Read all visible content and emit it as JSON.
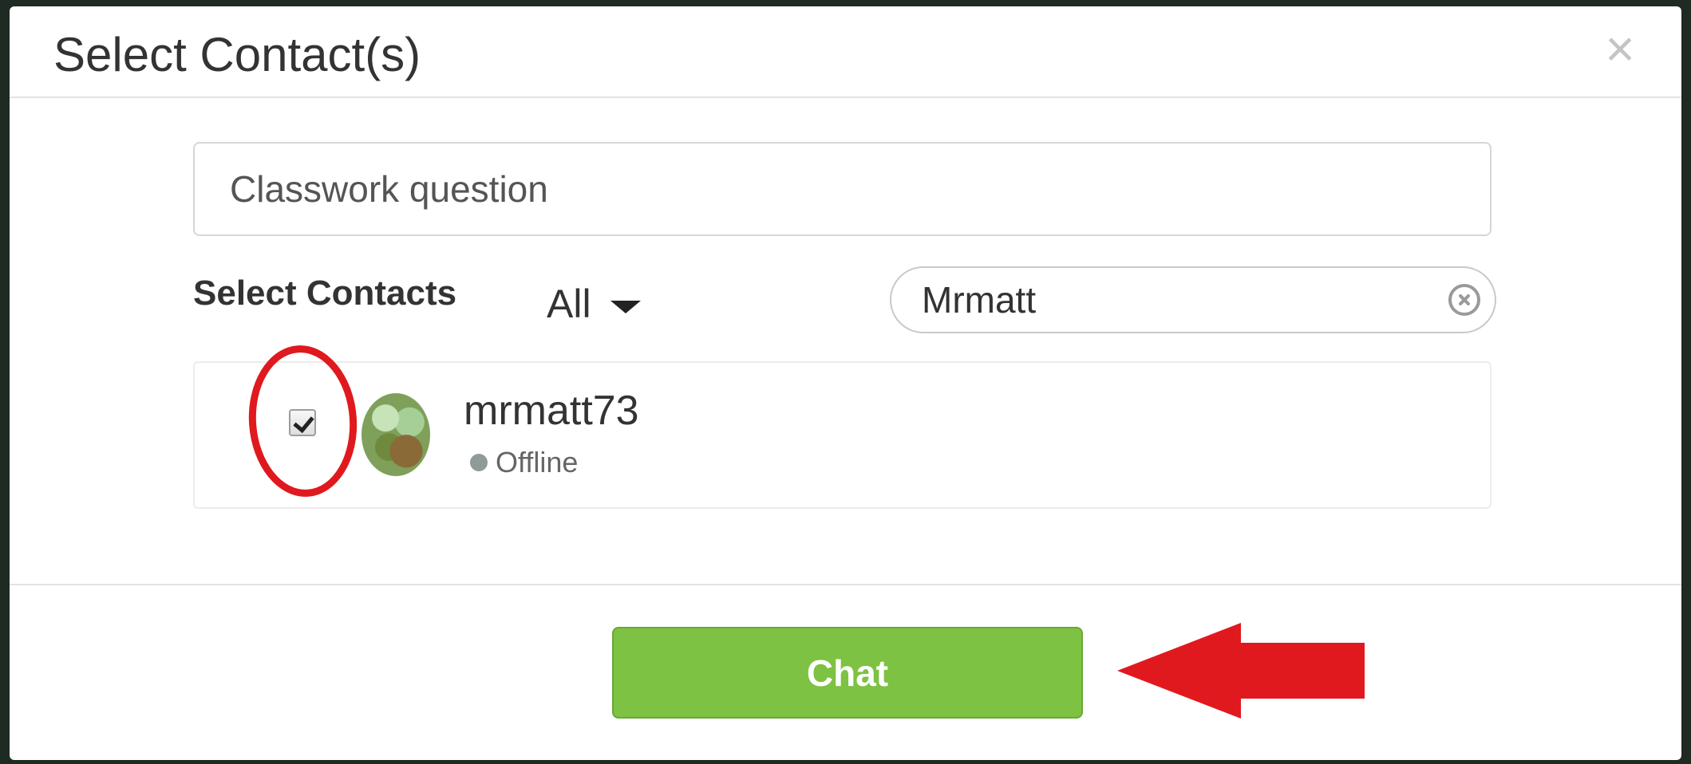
{
  "dialog": {
    "title": "Select Contact(s)",
    "close_symbol": "×"
  },
  "chat_name": {
    "value": "Classwork question"
  },
  "contacts": {
    "section_label": "Select Contacts",
    "filter": {
      "selected": "All"
    },
    "search": {
      "value": "Mrmatt"
    },
    "items": [
      {
        "name": "mrmatt73",
        "status": "Offline",
        "checked": true
      }
    ]
  },
  "footer": {
    "chat_label": "Chat"
  },
  "colors": {
    "accent_green": "#7dc242",
    "annotation_red": "#e0191e",
    "offline_dot": "#8f9a9a"
  },
  "icons": {
    "close": "close-icon",
    "dropdown": "caret-down-icon",
    "clear_search": "clear-search-icon",
    "checkbox": "checkbox-checked-icon",
    "avatar": "avatar",
    "annotation_arrow": "annotation-arrow-icon"
  }
}
